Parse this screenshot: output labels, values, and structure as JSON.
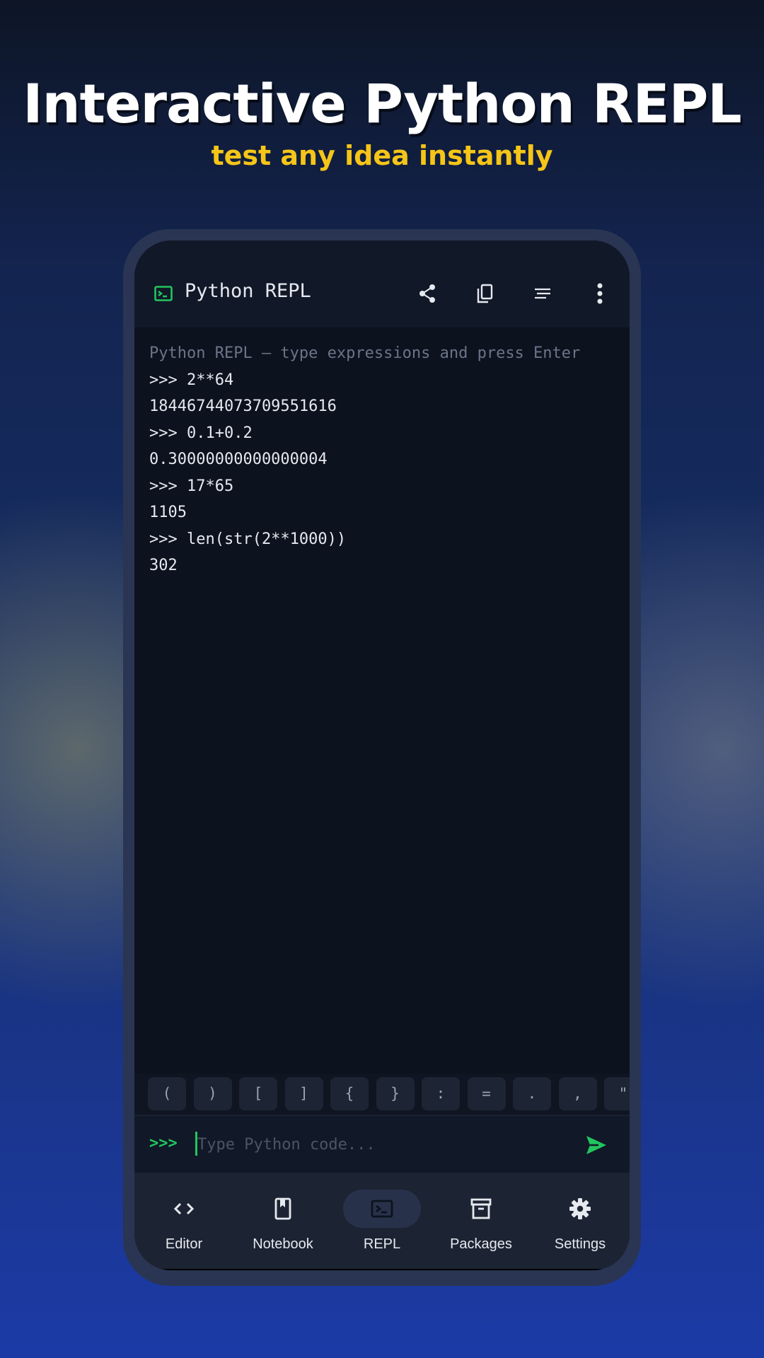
{
  "hero": {
    "title": "Interactive Python REPL",
    "subtitle": "test any idea instantly"
  },
  "app_bar": {
    "title": "Python REPL",
    "icon": "terminal-icon",
    "actions": [
      "share-icon",
      "copy-icon",
      "align-icon",
      "more-vert-icon"
    ]
  },
  "console": {
    "banner": "Python REPL — type expressions and press Enter",
    "lines": [
      ">>> 2**64",
      "18446744073709551616",
      ">>> 0.1+0.2",
      "0.30000000000000004",
      ">>> 17*65",
      "1105",
      ">>> len(str(2**1000))",
      "302"
    ]
  },
  "keys": [
    "(",
    ")",
    "[",
    "]",
    "{",
    "}",
    ":",
    "=",
    ".",
    ",",
    "\""
  ],
  "input": {
    "prompt": ">>>",
    "placeholder": "Type Python code...",
    "value": ""
  },
  "nav": {
    "items": [
      {
        "label": "Editor",
        "icon": "code-icon"
      },
      {
        "label": "Notebook",
        "icon": "book-icon"
      },
      {
        "label": "REPL",
        "icon": "terminal-icon"
      },
      {
        "label": "Packages",
        "icon": "archive-icon"
      },
      {
        "label": "Settings",
        "icon": "gear-icon"
      }
    ],
    "active": "REPL"
  },
  "colors": {
    "accent": "#22c55e",
    "headline_yellow": "#f5c518",
    "console_bg": "#0c121e",
    "nav_bg": "#1c2433"
  }
}
